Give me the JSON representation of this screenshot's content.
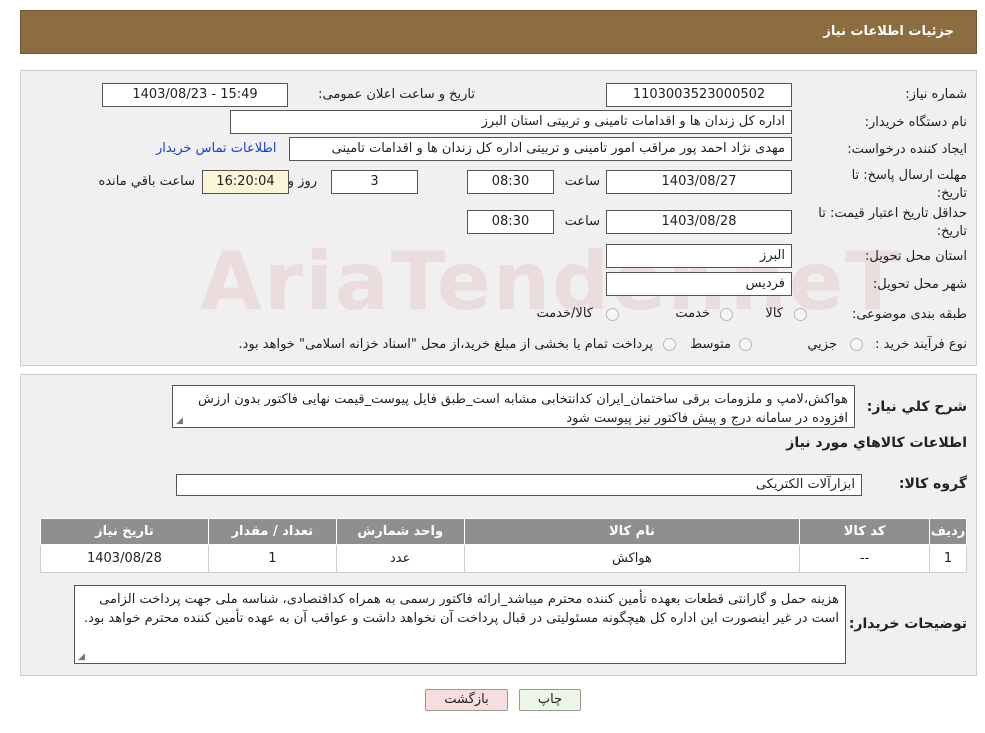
{
  "header": {
    "title": "جزئیات اطلاعات نیاز"
  },
  "form": {
    "need_number_label": "شماره نیاز:",
    "need_number": "1103003523000502",
    "announce_label": "تاریخ و ساعت اعلان عمومی:",
    "announce_value": "1403/08/23 - 15:49",
    "buyer_label": "نام دستگاه خریدار:",
    "buyer_value": "اداره کل زندان ها و اقدامات تامینی و تربیتی استان البرز",
    "creator_label": "ایجاد کننده درخواست:",
    "creator_value": "مهدی نژاد احمد پور مراقب امور تامینی و تربیتی اداره کل زندان ها و اقدامات تامینی",
    "contact_link": "اطلاعات تماس خریدار",
    "deadline_label": "مهلت ارسال پاسخ: تا تاریخ:",
    "deadline_date": "1403/08/27",
    "time_label": "ساعت",
    "deadline_time": "08:30",
    "days_value": "3",
    "days_label": "روز و",
    "remaining_time": "16:20:04",
    "remaining_label": "ساعت باقي مانده",
    "validity_label": "حداقل تاریخ اعتبار قیمت: تا تاریخ:",
    "validity_date": "1403/08/28",
    "validity_time": "08:30",
    "province_label": "استان محل تحویل:",
    "province_value": "البرز",
    "city_label": "شهر محل تحویل:",
    "city_value": "فردیس",
    "category_label": "طبقه بندی موضوعی:",
    "category_options": [
      "کالا",
      "خدمت",
      "کالا/خدمت"
    ],
    "process_label": "نوع فرآیند خرید :",
    "process_options": [
      "جزیي",
      "متوسط"
    ],
    "process_note": "پرداخت تمام یا بخشی از مبلغ خرید،از محل \"اسناد خزانه اسلامی\" خواهد بود."
  },
  "details": {
    "summary_label": "شرح کلي نياز:",
    "summary_value": "هواکش،لامپ و ملزومات برقی ساختمان_ایران کدانتخابی مشابه است_طبق فایل پیوست_قیمت نهایی فاکتور بدون ارزش افزوده در سامانه درج و پیش فاکتور نیز پیوست شود",
    "goods_info_title": "اطلاعات کالاهاي مورد نياز",
    "group_label": "گروه کالا:",
    "group_value": "ابزارآلات الکتریکی",
    "table": {
      "headers": [
        "رديف",
        "کد کالا",
        "نام کالا",
        "واحد شمارش",
        "تعداد / مقدار",
        "تاريخ نياز"
      ],
      "rows": [
        [
          "1",
          "--",
          "هواکش",
          "عدد",
          "1",
          "1403/08/28"
        ]
      ]
    },
    "buyer_notes_label": "توضیحات خریدار:",
    "buyer_notes": "هزینه حمل و گارانتی قطعات بعهده تأمین کننده محترم میباشد_ارائه فاکتور رسمی به همراه کداقتصادی، شناسه ملی جهت پرداخت الزامی است در غیر اینصورت این اداره کل هیچگونه مسئولیتی در قبال پرداخت آن نخواهد داشت و عواقب آن به عهده تأمین کننده محترم خواهد بود."
  },
  "buttons": {
    "print": "چاپ",
    "back": "بازگشت"
  },
  "watermark": "AriaTender.neT",
  "colors": {
    "header": "#8c6d3f",
    "back_button": "#f7dede",
    "print_button": "#ecf7e6"
  }
}
